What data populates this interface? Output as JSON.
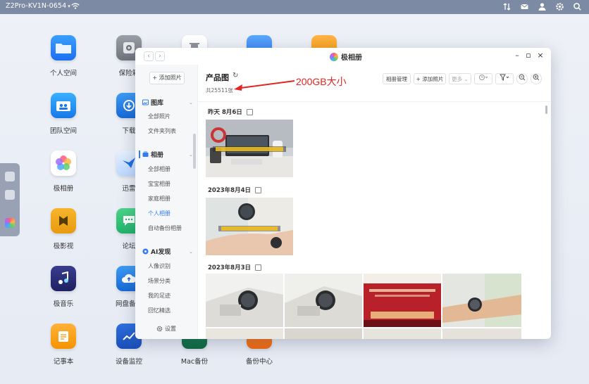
{
  "topbar": {
    "device": "Z2Pro-KV1N-0654"
  },
  "desktop": {
    "icons": [
      {
        "label": "个人空间"
      },
      {
        "label": "保险箱"
      },
      {
        "label": "团队空间"
      },
      {
        "label": "下载"
      },
      {
        "label": "极相册"
      },
      {
        "label": "迅雷"
      },
      {
        "label": "极影视"
      },
      {
        "label": "论坛"
      },
      {
        "label": "极音乐"
      },
      {
        "label": "网盘备份"
      },
      {
        "label": "记事本"
      },
      {
        "label": "设备监控"
      },
      {
        "label": "Mac备份"
      },
      {
        "label": "备份中心"
      }
    ]
  },
  "window": {
    "title": "极相册",
    "sidebar": {
      "upload": "+ 添加照片",
      "gallery": "图库",
      "gallery_items": [
        "全部照片",
        "文件夹列表"
      ],
      "albums": "相册",
      "album_items": [
        "全部相册",
        "宝宝相册",
        "家庭相册",
        "个人相册",
        "自动备份相册"
      ],
      "ai": "AI发现",
      "ai_items": [
        "人像识别",
        "场景分类",
        "我的足迹",
        "回忆精选"
      ],
      "settings": "设置"
    },
    "main": {
      "title": "产品图",
      "count": "共25511张",
      "toolbar": {
        "manage": "相册管理",
        "add": "+ 添加照片",
        "more": "更多",
        "more_caret": "⌄"
      },
      "groups": [
        {
          "date": "昨天 8月6日"
        },
        {
          "date": "2023年8月4日"
        },
        {
          "date": "2023年8月3日"
        }
      ]
    }
  },
  "annotation": {
    "text": "200GB大小",
    "color": "#e52421"
  },
  "colors": {
    "accent": "#2f7cf6",
    "topbar": "#7d8aa3"
  }
}
